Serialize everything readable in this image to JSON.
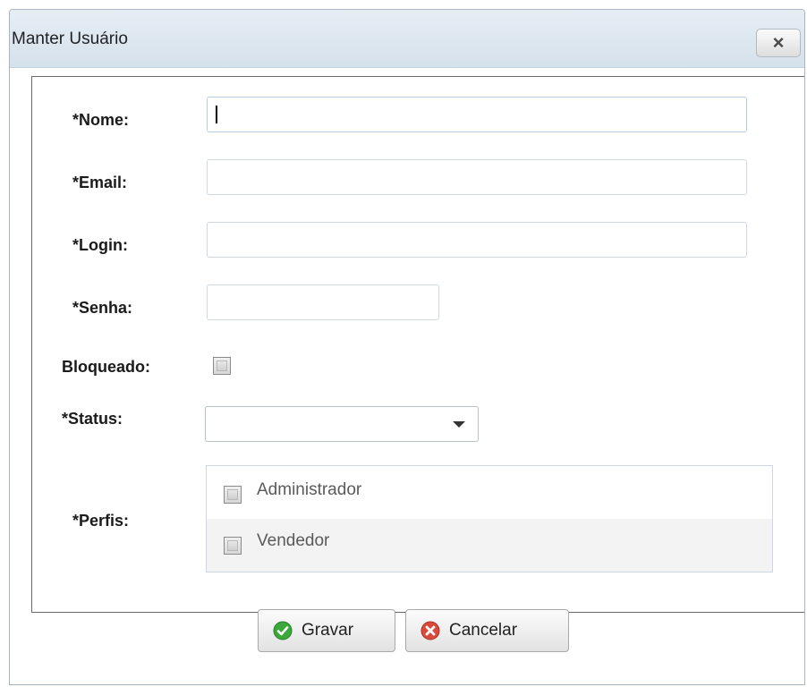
{
  "dialog": {
    "title": "Manter Usuário",
    "close_label": "×"
  },
  "form": {
    "nome": {
      "label": "*Nome:",
      "value": ""
    },
    "email": {
      "label": "*Email:",
      "value": ""
    },
    "login": {
      "label": "*Login:",
      "value": ""
    },
    "senha": {
      "label": "*Senha:",
      "value": ""
    },
    "bloqueado": {
      "label": "Bloqueado:",
      "checked": false
    },
    "status": {
      "label": "*Status:",
      "selected": ""
    },
    "perfis": {
      "label": "*Perfis:",
      "options": [
        {
          "label": "Administrador",
          "checked": false
        },
        {
          "label": "Vendedor",
          "checked": false
        }
      ]
    }
  },
  "actions": {
    "save_label": "Gravar",
    "cancel_label": "Cancelar"
  },
  "colors": {
    "save_icon": "#3aa83a",
    "cancel_icon": "#d94a3a"
  }
}
